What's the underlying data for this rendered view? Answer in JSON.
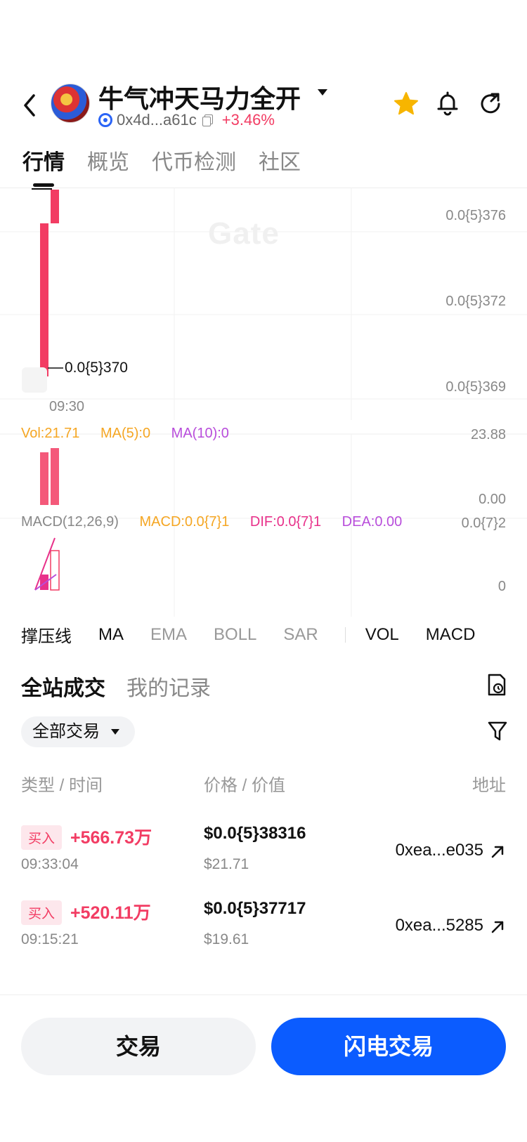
{
  "header": {
    "token_name": "牛气冲天马力全开",
    "address": "0x4d...a61c",
    "change": "+3.46%",
    "icons": [
      "back-arrow-icon",
      "token-avatar",
      "chain-icon",
      "copy-icon",
      "star-icon",
      "bell-icon",
      "share-icon"
    ]
  },
  "tabs": [
    {
      "label": "行情",
      "active": true
    },
    {
      "label": "概览",
      "active": false
    },
    {
      "label": "代币检测",
      "active": false
    },
    {
      "label": "社区",
      "active": false
    }
  ],
  "chart": {
    "watermark": "Gate",
    "y_labels": [
      "0.0{5}376",
      "0.0{5}372",
      "0.0{5}369"
    ],
    "current_price_label": "0.0{5}370",
    "time_label": "09:30",
    "volume": {
      "vol": "Vol:21.71",
      "ma5": "MA(5):0",
      "ma10": "MA(10):0",
      "y_top": "23.88",
      "y_bottom": "0.00"
    },
    "macd": {
      "title": "MACD(12,26,9)",
      "macd": "MACD:0.0{7}1",
      "dif": "DIF:0.0{7}1",
      "dea": "DEA:0.00",
      "y_top": "0.0{7}2",
      "y_bottom": "0"
    },
    "colors": {
      "up": "#f23c63",
      "orange": "#f5a623",
      "purple": "#b84ddb",
      "pink": "#e8318a"
    }
  },
  "indicators": {
    "items": [
      {
        "label": "撑压线",
        "active": true
      },
      {
        "label": "MA",
        "active": true
      },
      {
        "label": "EMA",
        "active": false
      },
      {
        "label": "BOLL",
        "active": false
      },
      {
        "label": "SAR",
        "active": false
      },
      {
        "label": "VOL",
        "active": true
      },
      {
        "label": "MACD",
        "active": true
      }
    ]
  },
  "trades": {
    "tabs": [
      {
        "label": "全站成交",
        "active": true
      },
      {
        "label": "我的记录",
        "active": false
      }
    ],
    "filter": "全部交易",
    "columns": {
      "type_time": "类型 / 时间",
      "price_value": "价格 / 价值",
      "address": "地址"
    },
    "rows": [
      {
        "type": "买入",
        "amount": "+566.73万",
        "time": "09:33:04",
        "price": "$0.0{5}38316",
        "value": "$21.71",
        "address": "0xea...e035"
      },
      {
        "type": "买入",
        "amount": "+520.11万",
        "time": "09:15:21",
        "price": "$0.0{5}37717",
        "value": "$19.61",
        "address": "0xea...5285"
      }
    ]
  },
  "actions": {
    "trade": "交易",
    "flash_trade": "闪电交易",
    "accent": "#0b5cff"
  }
}
